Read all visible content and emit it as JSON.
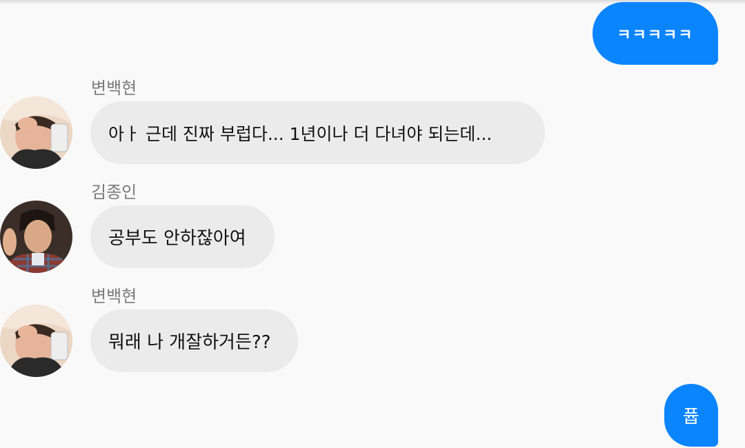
{
  "conversation": {
    "messages": [
      {
        "type": "outgoing",
        "text": "ㅋㅋㅋㅋㅋ"
      },
      {
        "type": "incoming",
        "sender": "변백현",
        "avatar": "baekhyun-avatar",
        "text": "아ㅏ 근데 진짜 부럽다... 1년이나 더 다녀야 되는데..."
      },
      {
        "type": "incoming",
        "sender": "김종인",
        "avatar": "jongin-avatar",
        "text": "공부도 안하잖아여"
      },
      {
        "type": "incoming",
        "sender": "변백현",
        "avatar": "baekhyun-avatar",
        "text": "뭐래 나 개잘하거든??"
      },
      {
        "type": "outgoing",
        "text": "퓹"
      }
    ]
  },
  "colors": {
    "background": "#f9f9f9",
    "outgoing_bubble": "#0a84ff",
    "incoming_bubble": "#ebebeb",
    "sender_name": "#7a7a7a",
    "message_text": "#111111"
  }
}
